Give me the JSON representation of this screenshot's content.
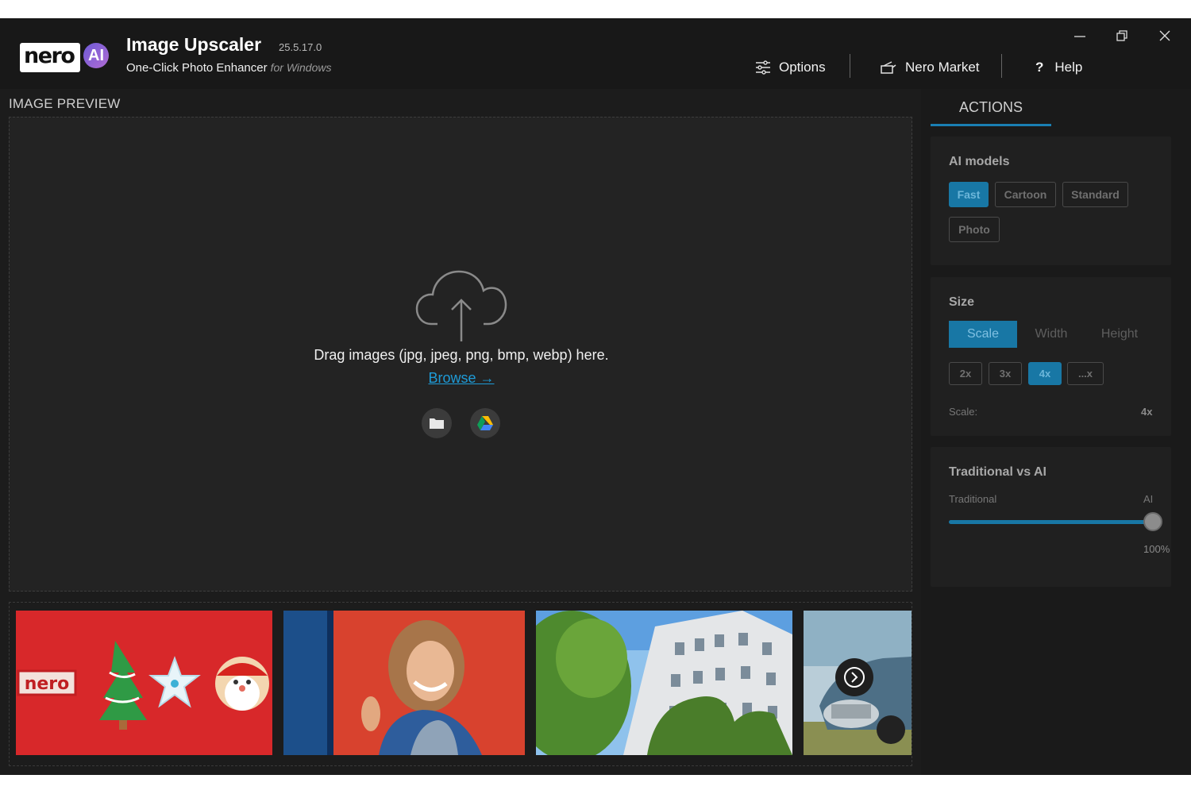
{
  "app": {
    "title": "Image Upscaler",
    "version": "25.5.17.0",
    "subtitle": "One-Click Photo Enhancer",
    "platform": "for Windows",
    "logo_text": "nero",
    "logo_badge": "AI"
  },
  "nav": {
    "options_label": "Options",
    "market_label": "Nero Market",
    "help_label": "Help",
    "help_glyph": "?"
  },
  "window_controls": [
    "minimize-icon",
    "restore-icon",
    "close-icon"
  ],
  "preview": {
    "section_label": "IMAGE PREVIEW",
    "drag_text": "Drag images (jpg, jpeg, png, bmp, webp) here.",
    "browse_label": "Browse →",
    "sources": [
      "folder-icon",
      "google-drive-icon"
    ]
  },
  "samples": [
    {
      "name": "sample-christmas-cookies",
      "logo_text": "nero"
    },
    {
      "name": "sample-portrait-woman"
    },
    {
      "name": "sample-ivy-building"
    },
    {
      "name": "sample-vintage-car"
    }
  ],
  "panel": {
    "tab_label": "ACTIONS",
    "ai_models": {
      "title": "AI models",
      "options": [
        "Fast",
        "Cartoon",
        "Standard",
        "Photo"
      ],
      "selected": "Fast"
    },
    "size": {
      "title": "Size",
      "modes": [
        "Scale",
        "Width",
        "Height"
      ],
      "selected_mode": "Scale",
      "scales": [
        "2x",
        "3x",
        "4x",
        "...x"
      ],
      "selected_scale": "4x",
      "scale_label": "Scale:",
      "scale_value": "4x"
    },
    "blend": {
      "title": "Traditional vs AI",
      "left_label": "Traditional",
      "right_label": "AI",
      "value_text": "100%",
      "value": 1.0
    }
  },
  "colors": {
    "accent": "#1877a5",
    "link": "#1e9bd7",
    "background": "#1c1c1c",
    "titlebar": "#181818"
  }
}
